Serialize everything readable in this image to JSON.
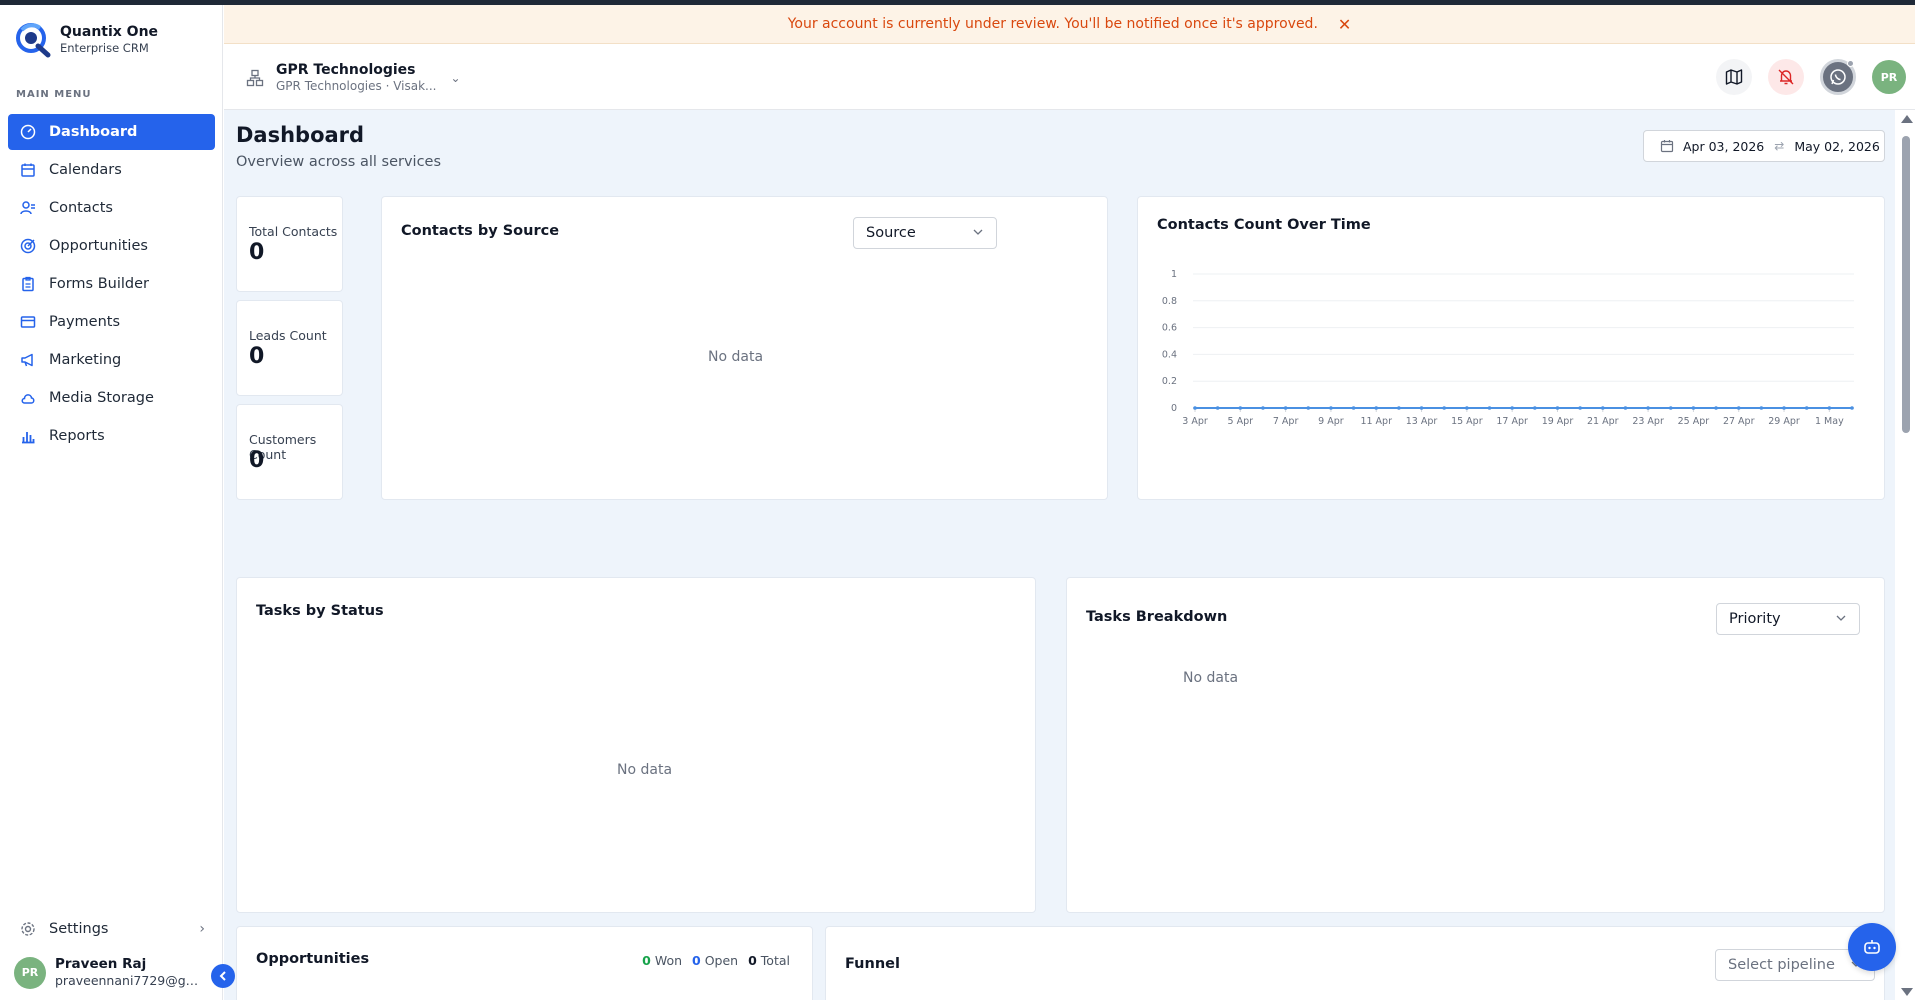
{
  "app": {
    "name": "Quantix One",
    "subtitle": "Enterprise CRM"
  },
  "banner": {
    "message": "Your account is currently under review. You'll be notified once it's approved.",
    "close_icon": "close-icon"
  },
  "sidebar": {
    "menu_heading": "MAIN MENU",
    "items": [
      {
        "label": "Dashboard",
        "icon": "dashboard-icon",
        "active": true
      },
      {
        "label": "Calendars",
        "icon": "calendar-icon",
        "active": false
      },
      {
        "label": "Contacts",
        "icon": "contacts-icon",
        "active": false
      },
      {
        "label": "Opportunities",
        "icon": "target-icon",
        "active": false
      },
      {
        "label": "Forms Builder",
        "icon": "clipboard-icon",
        "active": false
      },
      {
        "label": "Payments",
        "icon": "payments-icon",
        "active": false
      },
      {
        "label": "Marketing",
        "icon": "megaphone-icon",
        "active": false
      },
      {
        "label": "Media Storage",
        "icon": "cloud-icon",
        "active": false
      },
      {
        "label": "Reports",
        "icon": "bar-chart-icon",
        "active": false
      }
    ],
    "settings_label": "Settings",
    "user": {
      "initials": "PR",
      "name": "Praveen Raj",
      "email": "praveennani7729@gm..."
    }
  },
  "header": {
    "org_name": "GPR Technologies",
    "org_sub": "GPR Technologies · Visak...",
    "avatar_initials": "PR"
  },
  "dashboard": {
    "title": "Dashboard",
    "subtitle": "Overview across all services",
    "date_from": "Apr 03, 2026",
    "date_to": "May 02, 2026",
    "stats": [
      {
        "label": "Total Contacts",
        "value": "0"
      },
      {
        "label": "Leads Count",
        "value": "0"
      },
      {
        "label": "Customers Count",
        "value": "0"
      }
    ],
    "contacts_by_source": {
      "title": "Contacts by Source",
      "select_value": "Source",
      "empty": "No data"
    },
    "contacts_over_time": {
      "title": "Contacts Count Over Time"
    },
    "tasks_by_status": {
      "title": "Tasks by Status",
      "empty": "No data"
    },
    "tasks_breakdown": {
      "title": "Tasks Breakdown",
      "select_value": "Priority",
      "empty": "No data"
    },
    "opportunities": {
      "title": "Opportunities",
      "won_count": "0",
      "won_label": "Won",
      "open_count": "0",
      "open_label": "Open",
      "total_count": "0",
      "total_label": "Total"
    },
    "funnel": {
      "title": "Funnel",
      "select_placeholder": "Select pipeline"
    }
  },
  "colors": {
    "accent": "#2563eb",
    "banner_text": "#d9480f",
    "banner_bg": "#fdf3e7",
    "line": "#4a90e2"
  },
  "chart_data": {
    "type": "line",
    "x": [
      "3 Apr",
      "4 Apr",
      "5 Apr",
      "6 Apr",
      "7 Apr",
      "8 Apr",
      "9 Apr",
      "10 Apr",
      "11 Apr",
      "12 Apr",
      "13 Apr",
      "14 Apr",
      "15 Apr",
      "16 Apr",
      "17 Apr",
      "18 Apr",
      "19 Apr",
      "20 Apr",
      "21 Apr",
      "22 Apr",
      "23 Apr",
      "24 Apr",
      "25 Apr",
      "26 Apr",
      "27 Apr",
      "28 Apr",
      "29 Apr",
      "30 Apr",
      "1 May",
      "2 May"
    ],
    "x_tick_labels": [
      "3 Apr",
      "5 Apr",
      "7 Apr",
      "9 Apr",
      "11 Apr",
      "13 Apr",
      "15 Apr",
      "17 Apr",
      "19 Apr",
      "21 Apr",
      "23 Apr",
      "25 Apr",
      "27 Apr",
      "29 Apr",
      "1 May"
    ],
    "series": [
      {
        "values": [
          0,
          0,
          0,
          0,
          0,
          0,
          0,
          0,
          0,
          0,
          0,
          0,
          0,
          0,
          0,
          0,
          0,
          0,
          0,
          0,
          0,
          0,
          0,
          0,
          0,
          0,
          0,
          0,
          0,
          0
        ]
      }
    ],
    "ylim": [
      0,
      1
    ],
    "y_ticks": [
      0,
      0.2,
      0.4,
      0.6,
      0.8,
      1
    ],
    "title": "Contacts Count Over Time",
    "xlabel": "",
    "ylabel": "",
    "grid": true
  }
}
